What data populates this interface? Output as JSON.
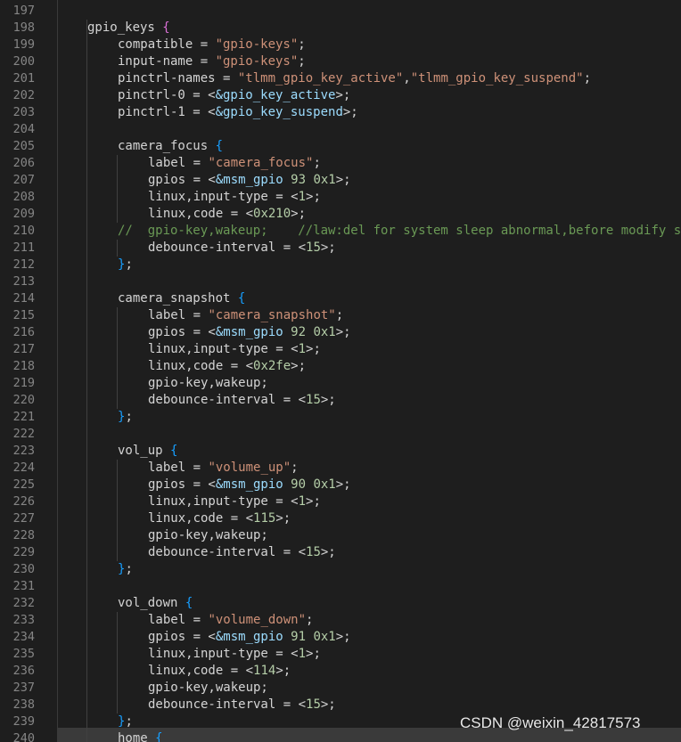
{
  "editor": {
    "lines": [
      {
        "n": "197",
        "indent": 0,
        "tokens": []
      },
      {
        "n": "198",
        "indent": 1,
        "tokens": [
          {
            "t": "gpio_keys ",
            "c": "t"
          },
          {
            "t": "{",
            "c": "bp"
          }
        ]
      },
      {
        "n": "199",
        "indent": 2,
        "tokens": [
          {
            "t": "compatible = ",
            "c": "t"
          },
          {
            "t": "\"gpio-keys\"",
            "c": "s"
          },
          {
            "t": ";",
            "c": "t"
          }
        ]
      },
      {
        "n": "200",
        "indent": 2,
        "tokens": [
          {
            "t": "input-name = ",
            "c": "t"
          },
          {
            "t": "\"gpio-keys\"",
            "c": "s"
          },
          {
            "t": ";",
            "c": "t"
          }
        ]
      },
      {
        "n": "201",
        "indent": 2,
        "tokens": [
          {
            "t": "pinctrl-names = ",
            "c": "t"
          },
          {
            "t": "\"tlmm_gpio_key_active\"",
            "c": "s"
          },
          {
            "t": ",",
            "c": "t"
          },
          {
            "t": "\"tlmm_gpio_key_suspend\"",
            "c": "s"
          },
          {
            "t": ";",
            "c": "t"
          }
        ]
      },
      {
        "n": "202",
        "indent": 2,
        "tokens": [
          {
            "t": "pinctrl-0 = <",
            "c": "t"
          },
          {
            "t": "&gpio_key_active",
            "c": "r"
          },
          {
            "t": ">;",
            "c": "t"
          }
        ]
      },
      {
        "n": "203",
        "indent": 2,
        "tokens": [
          {
            "t": "pinctrl-1 = <",
            "c": "t"
          },
          {
            "t": "&gpio_key_suspend",
            "c": "r"
          },
          {
            "t": ">;",
            "c": "t"
          }
        ]
      },
      {
        "n": "204",
        "indent": 0,
        "tokens": []
      },
      {
        "n": "205",
        "indent": 2,
        "tokens": [
          {
            "t": "camera_focus ",
            "c": "t"
          },
          {
            "t": "{",
            "c": "bb"
          }
        ]
      },
      {
        "n": "206",
        "indent": 3,
        "tokens": [
          {
            "t": "label = ",
            "c": "t"
          },
          {
            "t": "\"camera_focus\"",
            "c": "s"
          },
          {
            "t": ";",
            "c": "t"
          }
        ]
      },
      {
        "n": "207",
        "indent": 3,
        "tokens": [
          {
            "t": "gpios = <",
            "c": "t"
          },
          {
            "t": "&msm_gpio",
            "c": "r"
          },
          {
            "t": " ",
            "c": "t"
          },
          {
            "t": "93",
            "c": "n"
          },
          {
            "t": " ",
            "c": "t"
          },
          {
            "t": "0x1",
            "c": "n"
          },
          {
            "t": ">;",
            "c": "t"
          }
        ]
      },
      {
        "n": "208",
        "indent": 3,
        "tokens": [
          {
            "t": "linux,input-type = <",
            "c": "t"
          },
          {
            "t": "1",
            "c": "n"
          },
          {
            "t": ">;",
            "c": "t"
          }
        ]
      },
      {
        "n": "209",
        "indent": 3,
        "tokens": [
          {
            "t": "linux,code = <",
            "c": "t"
          },
          {
            "t": "0x210",
            "c": "n"
          },
          {
            "t": ">;",
            "c": "t"
          }
        ]
      },
      {
        "n": "210",
        "indent": 2,
        "tokens": [
          {
            "t": "//  gpio-key,wakeup;    //law:del for system sleep abnormal,before modify s",
            "c": "c"
          }
        ]
      },
      {
        "n": "211",
        "indent": 3,
        "tokens": [
          {
            "t": "debounce-interval = <",
            "c": "t"
          },
          {
            "t": "15",
            "c": "n"
          },
          {
            "t": ">;",
            "c": "t"
          }
        ]
      },
      {
        "n": "212",
        "indent": 2,
        "tokens": [
          {
            "t": "}",
            "c": "bb"
          },
          {
            "t": ";",
            "c": "t"
          }
        ]
      },
      {
        "n": "213",
        "indent": 0,
        "tokens": []
      },
      {
        "n": "214",
        "indent": 2,
        "tokens": [
          {
            "t": "camera_snapshot ",
            "c": "t"
          },
          {
            "t": "{",
            "c": "bb"
          }
        ]
      },
      {
        "n": "215",
        "indent": 3,
        "tokens": [
          {
            "t": "label = ",
            "c": "t"
          },
          {
            "t": "\"camera_snapshot\"",
            "c": "s"
          },
          {
            "t": ";",
            "c": "t"
          }
        ]
      },
      {
        "n": "216",
        "indent": 3,
        "tokens": [
          {
            "t": "gpios = <",
            "c": "t"
          },
          {
            "t": "&msm_gpio",
            "c": "r"
          },
          {
            "t": " ",
            "c": "t"
          },
          {
            "t": "92",
            "c": "n"
          },
          {
            "t": " ",
            "c": "t"
          },
          {
            "t": "0x1",
            "c": "n"
          },
          {
            "t": ">;",
            "c": "t"
          }
        ]
      },
      {
        "n": "217",
        "indent": 3,
        "tokens": [
          {
            "t": "linux,input-type = <",
            "c": "t"
          },
          {
            "t": "1",
            "c": "n"
          },
          {
            "t": ">;",
            "c": "t"
          }
        ]
      },
      {
        "n": "218",
        "indent": 3,
        "tokens": [
          {
            "t": "linux,code = <",
            "c": "t"
          },
          {
            "t": "0x2fe",
            "c": "n"
          },
          {
            "t": ">;",
            "c": "t"
          }
        ]
      },
      {
        "n": "219",
        "indent": 3,
        "tokens": [
          {
            "t": "gpio-key,wakeup;",
            "c": "t"
          }
        ]
      },
      {
        "n": "220",
        "indent": 3,
        "tokens": [
          {
            "t": "debounce-interval = <",
            "c": "t"
          },
          {
            "t": "15",
            "c": "n"
          },
          {
            "t": ">;",
            "c": "t"
          }
        ]
      },
      {
        "n": "221",
        "indent": 2,
        "tokens": [
          {
            "t": "}",
            "c": "bb"
          },
          {
            "t": ";",
            "c": "t"
          }
        ]
      },
      {
        "n": "222",
        "indent": 0,
        "tokens": []
      },
      {
        "n": "223",
        "indent": 2,
        "tokens": [
          {
            "t": "vol_up ",
            "c": "t"
          },
          {
            "t": "{",
            "c": "bb"
          }
        ]
      },
      {
        "n": "224",
        "indent": 3,
        "tokens": [
          {
            "t": "label = ",
            "c": "t"
          },
          {
            "t": "\"volume_up\"",
            "c": "s"
          },
          {
            "t": ";",
            "c": "t"
          }
        ]
      },
      {
        "n": "225",
        "indent": 3,
        "tokens": [
          {
            "t": "gpios = <",
            "c": "t"
          },
          {
            "t": "&msm_gpio",
            "c": "r"
          },
          {
            "t": " ",
            "c": "t"
          },
          {
            "t": "90",
            "c": "n"
          },
          {
            "t": " ",
            "c": "t"
          },
          {
            "t": "0x1",
            "c": "n"
          },
          {
            "t": ">;",
            "c": "t"
          }
        ]
      },
      {
        "n": "226",
        "indent": 3,
        "tokens": [
          {
            "t": "linux,input-type = <",
            "c": "t"
          },
          {
            "t": "1",
            "c": "n"
          },
          {
            "t": ">;",
            "c": "t"
          }
        ]
      },
      {
        "n": "227",
        "indent": 3,
        "tokens": [
          {
            "t": "linux,code = <",
            "c": "t"
          },
          {
            "t": "115",
            "c": "n"
          },
          {
            "t": ">;",
            "c": "t"
          }
        ]
      },
      {
        "n": "228",
        "indent": 3,
        "tokens": [
          {
            "t": "gpio-key,wakeup;",
            "c": "t"
          }
        ]
      },
      {
        "n": "229",
        "indent": 3,
        "tokens": [
          {
            "t": "debounce-interval = <",
            "c": "t"
          },
          {
            "t": "15",
            "c": "n"
          },
          {
            "t": ">;",
            "c": "t"
          }
        ]
      },
      {
        "n": "230",
        "indent": 2,
        "tokens": [
          {
            "t": "}",
            "c": "bb"
          },
          {
            "t": ";",
            "c": "t"
          }
        ]
      },
      {
        "n": "231",
        "indent": 0,
        "tokens": []
      },
      {
        "n": "232",
        "indent": 2,
        "tokens": [
          {
            "t": "vol_down ",
            "c": "t"
          },
          {
            "t": "{",
            "c": "bb"
          }
        ]
      },
      {
        "n": "233",
        "indent": 3,
        "tokens": [
          {
            "t": "label = ",
            "c": "t"
          },
          {
            "t": "\"volume_down\"",
            "c": "s"
          },
          {
            "t": ";",
            "c": "t"
          }
        ]
      },
      {
        "n": "234",
        "indent": 3,
        "tokens": [
          {
            "t": "gpios = <",
            "c": "t"
          },
          {
            "t": "&msm_gpio",
            "c": "r"
          },
          {
            "t": " ",
            "c": "t"
          },
          {
            "t": "91",
            "c": "n"
          },
          {
            "t": " ",
            "c": "t"
          },
          {
            "t": "0x1",
            "c": "n"
          },
          {
            "t": ">;",
            "c": "t"
          }
        ]
      },
      {
        "n": "235",
        "indent": 3,
        "tokens": [
          {
            "t": "linux,input-type = <",
            "c": "t"
          },
          {
            "t": "1",
            "c": "n"
          },
          {
            "t": ">;",
            "c": "t"
          }
        ]
      },
      {
        "n": "236",
        "indent": 3,
        "tokens": [
          {
            "t": "linux,code = <",
            "c": "t"
          },
          {
            "t": "114",
            "c": "n"
          },
          {
            "t": ">;",
            "c": "t"
          }
        ]
      },
      {
        "n": "237",
        "indent": 3,
        "tokens": [
          {
            "t": "gpio-key,wakeup;",
            "c": "t"
          }
        ]
      },
      {
        "n": "238",
        "indent": 3,
        "tokens": [
          {
            "t": "debounce-interval = <",
            "c": "t"
          },
          {
            "t": "15",
            "c": "n"
          },
          {
            "t": ">;",
            "c": "t"
          }
        ]
      },
      {
        "n": "239",
        "indent": 2,
        "tokens": [
          {
            "t": "}",
            "c": "bb"
          },
          {
            "t": ";",
            "c": "t"
          }
        ]
      },
      {
        "n": "240",
        "indent": 2,
        "tokens": [
          {
            "t": "home ",
            "c": "t"
          },
          {
            "t": "{",
            "c": "bb"
          }
        ]
      }
    ]
  },
  "watermark": "CSDN @weixin_42817573",
  "colors": {
    "background": "#1e1e1e",
    "line_number": "#858585",
    "text": "#d4d4d4",
    "string": "#ce9178",
    "reference": "#9cdcfe",
    "comment": "#6a9955",
    "number": "#b5cea8",
    "bracket_level1": "#da70d6",
    "bracket_level2": "#179fff"
  }
}
